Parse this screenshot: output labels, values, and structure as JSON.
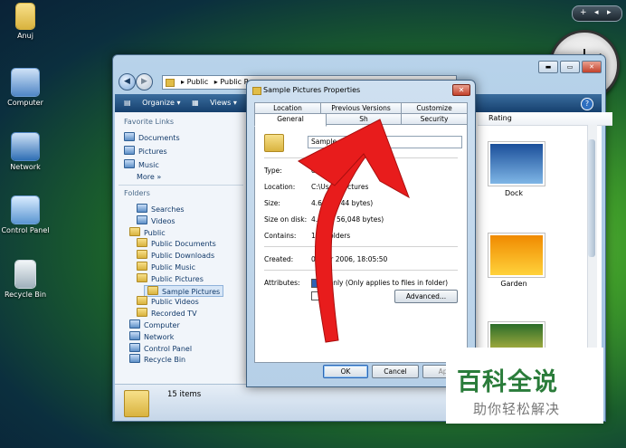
{
  "desktop": {
    "icons": [
      {
        "label": "Anuj",
        "color": "#d9b33f"
      },
      {
        "label": "Computer",
        "color": "#6fa0d8"
      },
      {
        "label": "Network",
        "color": "#4f86c6"
      },
      {
        "label": "Control Panel",
        "color": "#6fa0d8"
      },
      {
        "label": "Recycle Bin",
        "color": "#cfd8df"
      }
    ],
    "gadget_bar": {
      "add": "+",
      "prev": "◂",
      "next": "▸"
    }
  },
  "explorer": {
    "title_buttons": {
      "minimize": "▬",
      "maximize": "▭",
      "close": "✕"
    },
    "address": {
      "parts": [
        "Public",
        "Public P"
      ]
    },
    "toolbar": {
      "organize": "Organize",
      "views": "Views"
    },
    "nav_pane": {
      "favorite_links_header": "Favorite Links",
      "favorites": [
        "Documents",
        "Pictures",
        "Music"
      ],
      "more": "More",
      "more_icon": "»",
      "folders_header": "Folders",
      "tree": [
        {
          "label": "Searches",
          "indent": 1,
          "icon": "blue"
        },
        {
          "label": "Videos",
          "indent": 1,
          "icon": "blue"
        },
        {
          "label": "Public",
          "indent": 0,
          "icon": "folder"
        },
        {
          "label": "Public Documents",
          "indent": 1,
          "icon": "folder"
        },
        {
          "label": "Public Downloads",
          "indent": 1,
          "icon": "folder"
        },
        {
          "label": "Public Music",
          "indent": 1,
          "icon": "folder"
        },
        {
          "label": "Public Pictures",
          "indent": 1,
          "icon": "folder"
        },
        {
          "label": "Sample Pictures",
          "indent": 2,
          "icon": "folder"
        },
        {
          "label": "Public Videos",
          "indent": 1,
          "icon": "folder"
        },
        {
          "label": "Recorded TV",
          "indent": 1,
          "icon": "folder"
        },
        {
          "label": "Computer",
          "indent": 0,
          "icon": "blue"
        },
        {
          "label": "Network",
          "indent": 0,
          "icon": "blue"
        },
        {
          "label": "Control Panel",
          "indent": 0,
          "icon": "blue"
        },
        {
          "label": "Recycle Bin",
          "indent": 0,
          "icon": "blue"
        }
      ]
    },
    "column_header": "Rating",
    "thumbnails": [
      {
        "label": "Dock",
        "colors": [
          "#1b4f9a",
          "#7fb6e6"
        ]
      },
      {
        "label": "Garden",
        "colors": [
          "#f08a00",
          "#ffd23b"
        ]
      },
      {
        "label": "",
        "colors": [
          "#2b6d2a",
          "#e8d04a"
        ]
      }
    ],
    "partial_labels": {
      "s": "s",
      "les": "les"
    },
    "status": "15 items"
  },
  "dialog": {
    "title": "Sample Pictures Properties",
    "close": "✕",
    "tabs_top": [
      "Location",
      "Previous Versions",
      "Customize"
    ],
    "tabs_bottom": [
      "General",
      "Sh",
      "Security"
    ],
    "name_value": "Sample",
    "rows": [
      {
        "label": "Type:",
        "value": "e folder"
      },
      {
        "label": "Location:",
        "value": "C:\\Users        Pictures"
      },
      {
        "label": "Size:",
        "value": "4.60 M        744 bytes)"
      },
      {
        "label": "Size on disk:",
        "value": "4.64 M        56,048 bytes)"
      },
      {
        "label": "Contains:",
        "value": "16 Fi        olders"
      },
      {
        "label": "Created:",
        "value": "02        ber 2006, 18:05:50"
      }
    ],
    "attributes_label": "Attributes:",
    "readonly_text": "d-only (Only applies to files in folder)",
    "hidden_text": "en",
    "advanced": "Advanced...",
    "ok": "OK",
    "cancel": "Cancel",
    "apply": "App"
  },
  "watermark": {
    "big": "百科全说",
    "small": "助你轻松解决"
  }
}
